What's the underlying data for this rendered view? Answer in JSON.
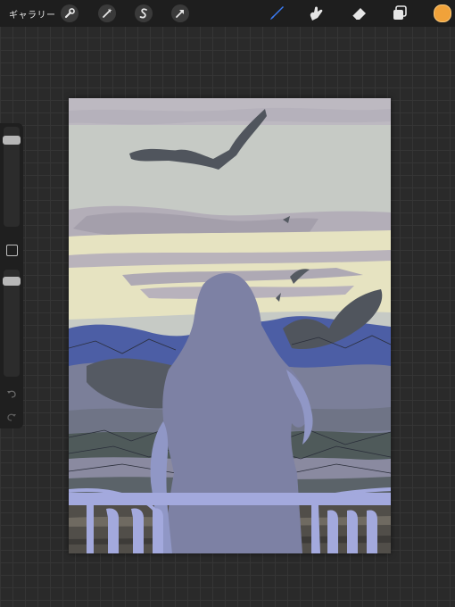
{
  "toolbar": {
    "gallery_label": "ギャラリー",
    "left_tools": [
      {
        "name": "actions",
        "icon": "wrench-icon"
      },
      {
        "name": "adjustments",
        "icon": "magic-wand-icon"
      },
      {
        "name": "selection",
        "icon": "selection-s-icon"
      },
      {
        "name": "transform",
        "icon": "arrow-cursor-icon"
      }
    ],
    "right_tools": [
      {
        "name": "brush",
        "icon": "brush-icon",
        "active": true
      },
      {
        "name": "smudge",
        "icon": "smudge-icon",
        "active": false
      },
      {
        "name": "eraser",
        "icon": "eraser-icon",
        "active": false
      },
      {
        "name": "layers",
        "icon": "layers-icon",
        "active": false
      }
    ],
    "current_color": "#f0a23a",
    "active_tool_color": "#3b7cf5"
  },
  "sidebar": {
    "brush_size_level": 0.08,
    "opacity_level": 0.05,
    "buttons": [
      "modify-button",
      "undo-button",
      "redo-button"
    ]
  },
  "canvas": {
    "palette": {
      "sky": "#c5c8c3",
      "cloud": "#b4b0b9",
      "glow": "#e6e3c0",
      "mountain_blue": "#4b5ea6",
      "shadow": "#555a63",
      "figure": "#7d81a4",
      "railing": "#a3a9dd",
      "bird": "#4e535c"
    }
  }
}
